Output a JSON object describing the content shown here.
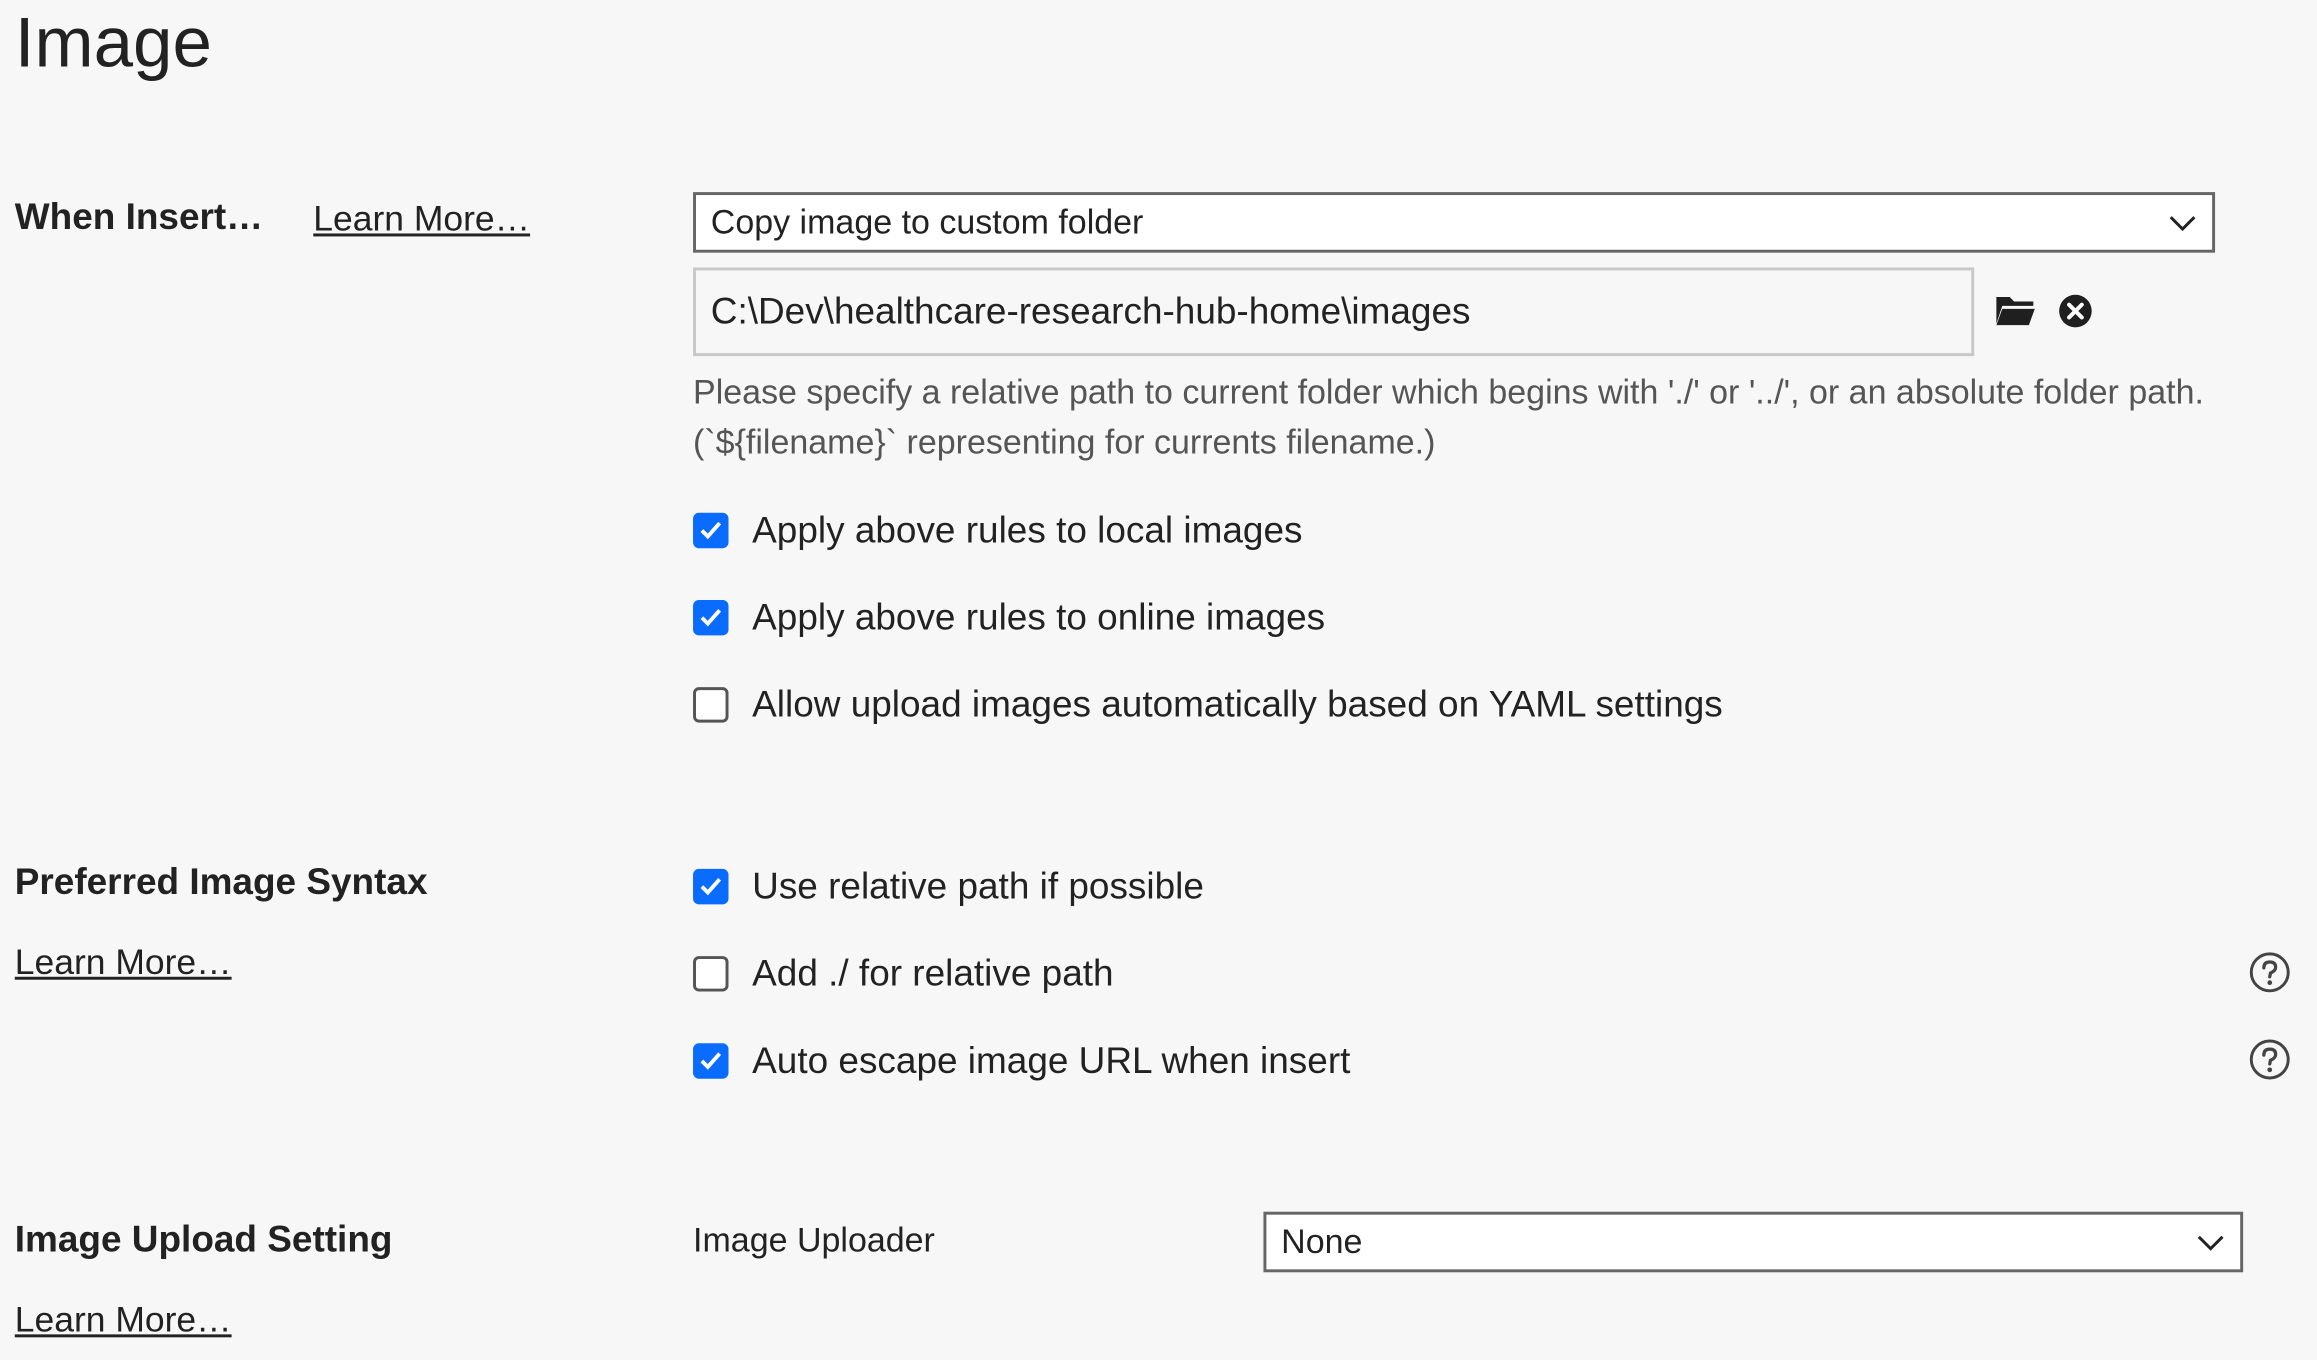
{
  "page_title": "Image",
  "when_insert": {
    "label": "When Insert…",
    "learn_more": "Learn More…",
    "action_select": "Copy image to custom folder",
    "folder_path": "C:\\Dev\\healthcare-research-hub-home\\images",
    "hint": " Please specify a relative path to current folder which begins with './' or '../', or an absolute folder path. (`${filename}` representing for currents filename.)",
    "options": [
      {
        "label": "Apply above rules to local images",
        "checked": true
      },
      {
        "label": "Apply above rules to online images",
        "checked": true
      },
      {
        "label": "Allow upload images automatically based on YAML settings",
        "checked": false
      }
    ]
  },
  "preferred_syntax": {
    "label": "Preferred Image Syntax",
    "learn_more": "Learn More…",
    "options": [
      {
        "label": "Use relative path if possible",
        "checked": true
      },
      {
        "label": "Add ./ for relative path",
        "checked": false
      },
      {
        "label": "Auto escape image URL when insert",
        "checked": true
      }
    ]
  },
  "upload_setting": {
    "label": "Image Upload Setting",
    "learn_more": "Learn More…",
    "uploader_label": "Image Uploader",
    "uploader_value": "None"
  },
  "colors": {
    "accent": "#0a6cff",
    "background": "#f7f7f7",
    "text": "#1f1f1f",
    "muted_text": "#555555"
  },
  "icons": {
    "folder": "folder-icon",
    "clear": "clear-icon",
    "chevron": "chevron-down-icon",
    "help": "help-icon",
    "check": "checkmark-icon"
  }
}
